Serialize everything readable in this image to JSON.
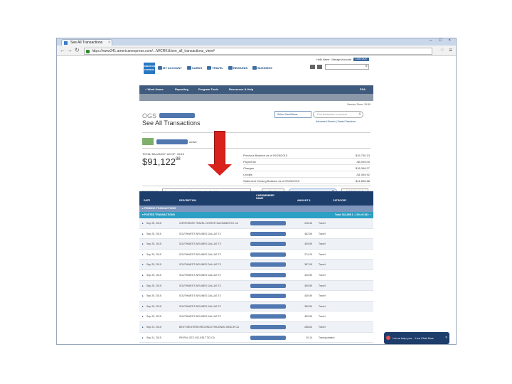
{
  "browser": {
    "tab_title": "See All Transactions",
    "tab_close": "×",
    "window_controls": "– □ ×",
    "url": "https://www241.americanexpress.com/.../WCRKU/see_all_transactions_view#"
  },
  "header": {
    "logo_text": "AMERICAN EXPRESS",
    "nav": [
      "MY ACCOUNT",
      "CARDS",
      "TRAVEL",
      "REWARDS",
      "BUSINESS"
    ],
    "util_links": [
      "Hello Name",
      "Manage Accounts"
    ],
    "logout_label": "LOG OUT"
  },
  "menu": [
    "Work Home",
    "Reporting",
    "Program Tools",
    "Resources & Help"
  ],
  "menu_right": "FSA",
  "summary": {
    "session": "Session Timer: 29:59",
    "card_name": "OGS",
    "page_title": "See All Transactions",
    "card_select": "Select Card/Name",
    "search_placeholder": "Find transaction or account",
    "search_links": "Advanced Search | Saved Searches",
    "card_status": "Active",
    "total_label": "TOTAL BALANCE* AS OF: 10/15",
    "total_whole": "$91,122",
    "total_cents": "88",
    "balances": [
      {
        "label": "Previous Balance as of 09/26/2015",
        "value": "$16,736.13"
      },
      {
        "label": "Payments",
        "value": "-$5,005.00"
      },
      {
        "label": "Charges",
        "value": "$18,348.27"
      },
      {
        "label": "Credits",
        "value": "-$1,095.92"
      },
      {
        "label": "Statement Closing Balance as of 09/26/2015",
        "value": "$41,896.88"
      }
    ],
    "period_label": "TIME PERIOD",
    "period_value": "Current Statement: Aug 26, 2015 to Sep 25, 2015",
    "period_caret": "▾",
    "filter_label": "Filter By",
    "download_label": "⬇ DOWNLOAD"
  },
  "transactions": {
    "columns": [
      "DATE",
      "DESCRIPTION",
      "CARDMEMBER NAME",
      "AMOUNT $",
      "CATEGORY"
    ],
    "pending_label": "▸ PENDING TRANSACTIONS",
    "posted_label": "▾ POSTED TRANSACTIONS",
    "posted_totals": "Total: $12,568   1 - 100 of 128 ‹ ›",
    "rows": [
      {
        "date": "Sep 25, 2015",
        "desc": "CORPORATE TRAVEL CENTER SACRAMENTO CA",
        "amount": "218.40",
        "category": "Travel"
      },
      {
        "date": "Sep 25, 2015",
        "desc": "SOUTHWEST AIRLINES DALLAS TX",
        "amount": "482.59",
        "category": "Travel"
      },
      {
        "date": "Sep 25, 2015",
        "desc": "SOUTHWEST AIRLINES DALLAS TX",
        "amount": "409.59",
        "category": "Travel"
      },
      {
        "date": "Sep 25, 2015",
        "desc": "SOUTHWEST AIRLINES DALLAS TX",
        "amount": "274.29",
        "category": "Travel"
      },
      {
        "date": "Sep 25, 2015",
        "desc": "SOUTHWEST AIRLINES DALLAS TX",
        "amount": "387.09",
        "category": "Travel"
      },
      {
        "date": "Sep 25, 2015",
        "desc": "SOUTHWEST AIRLINES DALLAS TX",
        "amount": "425.59",
        "category": "Travel"
      },
      {
        "date": "Sep 25, 2015",
        "desc": "SOUTHWEST AIRLINES DALLAS TX",
        "amount": "459.59",
        "category": "Travel"
      },
      {
        "date": "Sep 25, 2015",
        "desc": "SOUTHWEST AIRLINES DALLAS TX",
        "amount": "435.59",
        "category": "Travel"
      },
      {
        "date": "Sep 25, 2015",
        "desc": "SOUTHWEST AIRLINES DALLAS TX",
        "amount": "389.59",
        "category": "Travel"
      },
      {
        "date": "Sep 25, 2015",
        "desc": "SOUTHWEST AIRLINES DALLAS TX",
        "amount": "482.59",
        "category": "Travel"
      },
      {
        "date": "Sep 24, 2015",
        "desc": "BEST WESTERN REDONDO REDONDO BEACH CA",
        "amount": "268.63",
        "category": "Travel"
      },
      {
        "date": "Sep 24, 2015",
        "desc": "PAYPAL GEC 402-935-7733 CA",
        "amount": "29.10",
        "category": "Transportation"
      }
    ]
  },
  "chat": {
    "label": "Let us help you... Live Chat Now",
    "close": "×"
  },
  "colors": {
    "brand_blue": "#1d3d6b",
    "posted_bar": "#2c9fc4",
    "arrow": "#d9221c"
  }
}
